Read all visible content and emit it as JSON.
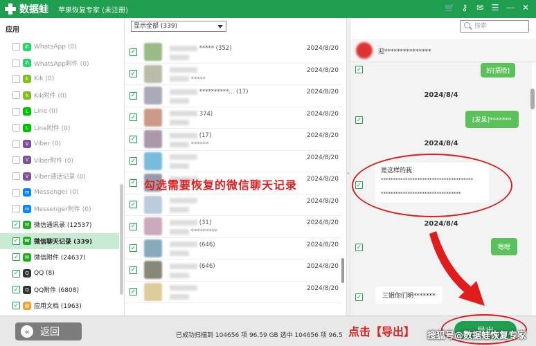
{
  "titlebar": {
    "app_name": "数据蛙",
    "subtitle": "苹果恢复专家 (未注册)",
    "icons": [
      "cart-icon",
      "key-icon",
      "chat-icon",
      "menu-icon",
      "minimize-icon",
      "close-icon"
    ]
  },
  "sidebar": {
    "section": "应用",
    "items": [
      {
        "label": "WhatsApp (0)",
        "icon": "whatsapp-icon",
        "checked": false
      },
      {
        "label": "WhatsApp附件 (0)",
        "icon": "whatsapp-icon",
        "checked": false
      },
      {
        "label": "Kik (0)",
        "icon": "kik-icon",
        "checked": false
      },
      {
        "label": "Kik附件 (0)",
        "icon": "kik-icon",
        "checked": false
      },
      {
        "label": "Line (0)",
        "icon": "line-icon",
        "checked": false
      },
      {
        "label": "Line附件 (0)",
        "icon": "line-icon",
        "checked": false
      },
      {
        "label": "Viber (0)",
        "icon": "viber-icon",
        "checked": false
      },
      {
        "label": "Viber附件 (0)",
        "icon": "viber-icon",
        "checked": false
      },
      {
        "label": "Viber通话记录 (0)",
        "icon": "viber-icon",
        "checked": false
      },
      {
        "label": "Messenger (0)",
        "icon": "messenger-icon",
        "checked": false
      },
      {
        "label": "Messenger附件 (0)",
        "icon": "messenger-icon",
        "checked": false
      },
      {
        "label": "微信通讯录 (12537)",
        "icon": "wechat-icon",
        "checked": true
      },
      {
        "label": "微信聊天记录 (339)",
        "icon": "wechat-icon",
        "checked": true,
        "active": true
      },
      {
        "label": "微信附件 (24637)",
        "icon": "wechat-icon",
        "checked": true
      },
      {
        "label": "QQ (8)",
        "icon": "qq-icon",
        "checked": true
      },
      {
        "label": "QQ附件 (6808)",
        "icon": "qq-icon",
        "checked": true
      },
      {
        "label": "应用文档 (1963)",
        "icon": "document-icon",
        "checked": true
      }
    ]
  },
  "filter": {
    "selected": "显示全部 (339)"
  },
  "messages": [
    {
      "name": "***** (352)",
      "preview": "",
      "date": "2024/8/20"
    },
    {
      "name": "",
      "preview": "*****",
      "date": "2024/8/20"
    },
    {
      "name": "**********... (17)",
      "preview": "",
      "date": "2024/8/20"
    },
    {
      "name": "374)",
      "preview": "",
      "date": "2024/8/20"
    },
    {
      "name": "(17)",
      "preview": "******",
      "date": "2024/8/20"
    },
    {
      "name": "",
      "preview": "",
      "date": "2024/8/20"
    },
    {
      "name": "",
      "preview": "",
      "date": "2024/8/20"
    },
    {
      "name": "",
      "preview": "",
      "date": "2024/8/20"
    },
    {
      "name": "(31)",
      "preview": "*********",
      "date": "2024/8/20"
    },
    {
      "name": "(646)",
      "preview": "",
      "date": "2024/8/20"
    },
    {
      "name": "(646)",
      "preview": "",
      "date": "2024/8/20"
    },
    {
      "name": "",
      "preview": "",
      "date": "2024/8/20"
    }
  ],
  "search": {
    "placeholder": "搜索"
  },
  "chat": {
    "header_title": "迎***************",
    "bubbles": [
      {
        "text": "好[捂脸]",
        "side": "me"
      },
      {
        "text": "2024/8/4",
        "side": "date"
      },
      {
        "text": "[发呆]*******",
        "side": "me"
      },
      {
        "text": "2024/8/4",
        "side": "date"
      },
      {
        "text": "是这样的我",
        "side": "other"
      },
      {
        "text": "**************************************",
        "side": "other"
      },
      {
        "text": "*********************************",
        "side": "other"
      },
      {
        "text": "2024/8/4",
        "side": "date"
      },
      {
        "text": "嗯嗯",
        "side": "me"
      },
      {
        "text": "三姐你们明*******",
        "side": "other"
      }
    ]
  },
  "annotation": {
    "select_hint": "勾选需要恢复的微信聊天记录",
    "click_hint": "点击【导出】"
  },
  "bottom": {
    "back_label": "返回",
    "status": "已成功扫描到 104656 项 96.59 GB  选中 104656 项 96.5",
    "export_label": "导出",
    "watermark": "搜狐号@数据蛙恢复专家"
  },
  "colors": {
    "titlebar": "#1e9e4e",
    "active_row": "#c8ecd3",
    "annotation": "#e02020",
    "bubble_me": "#5cc15a"
  }
}
